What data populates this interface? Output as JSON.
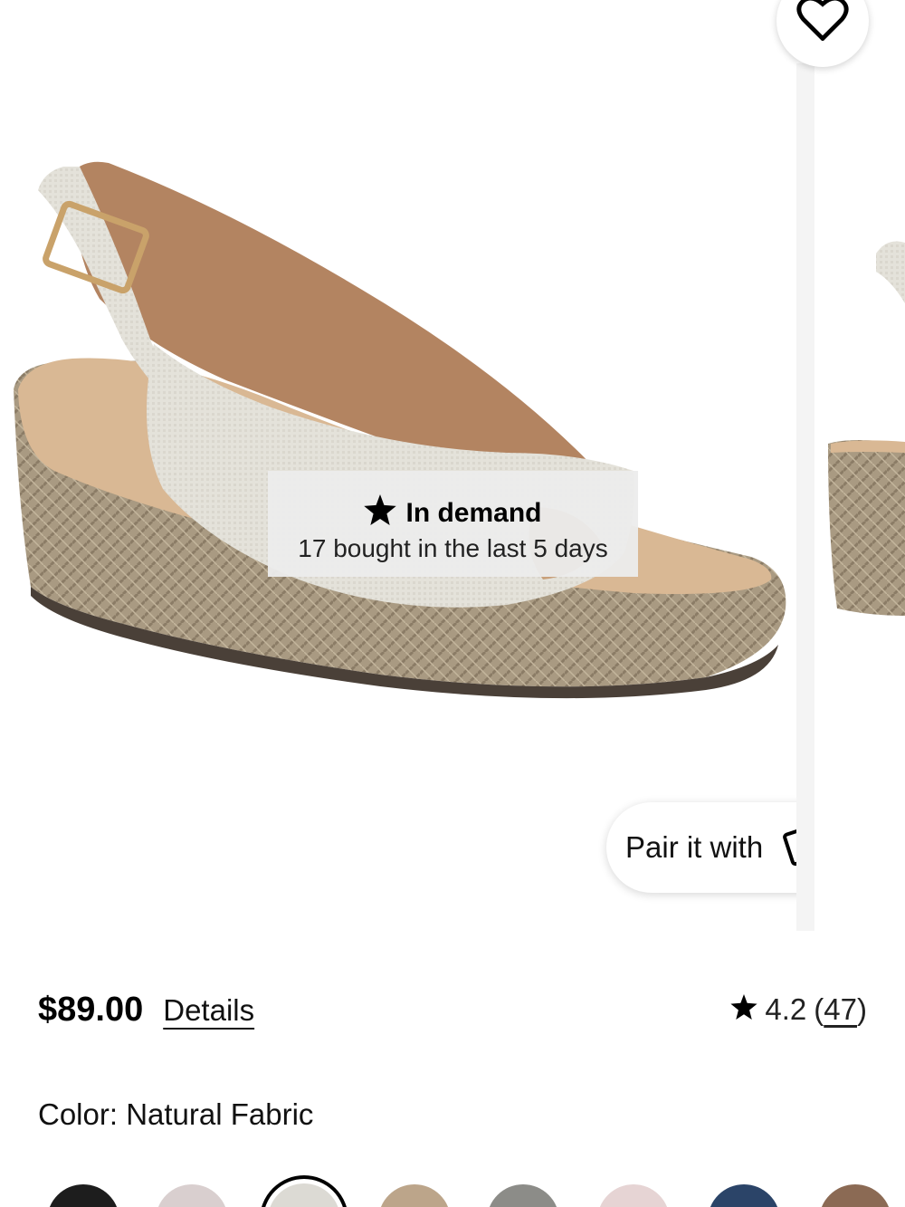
{
  "wishlist": {
    "icon": "heart-outline-icon"
  },
  "badge": {
    "icon": "star-filled-icon",
    "title": "In demand",
    "subtitle": "17 bought in the last 5 days"
  },
  "pair": {
    "label": "Pair it with",
    "icon": "cards-icon"
  },
  "product": {
    "price": "$89.00",
    "details_label": "Details",
    "rating_value": "4.2",
    "rating_open": "(",
    "rating_count": "47",
    "rating_close": ")"
  },
  "color": {
    "label": "Color: Natural Fabric"
  },
  "swatches": [
    {
      "name": "black",
      "color": "#1d1d1d",
      "selected": false
    },
    {
      "name": "floral",
      "color": "#d9cfcf",
      "selected": false
    },
    {
      "name": "natural-fabric",
      "color": "#dcdad4",
      "selected": true
    },
    {
      "name": "tan",
      "color": "#bca58a",
      "selected": false
    },
    {
      "name": "leopard",
      "color": "#8c8c88",
      "selected": false
    },
    {
      "name": "blush",
      "color": "#e6d4d4",
      "selected": false
    },
    {
      "name": "navy",
      "color": "#2b4468",
      "selected": false
    },
    {
      "name": "brown",
      "color": "#8b6a54",
      "selected": false
    }
  ]
}
